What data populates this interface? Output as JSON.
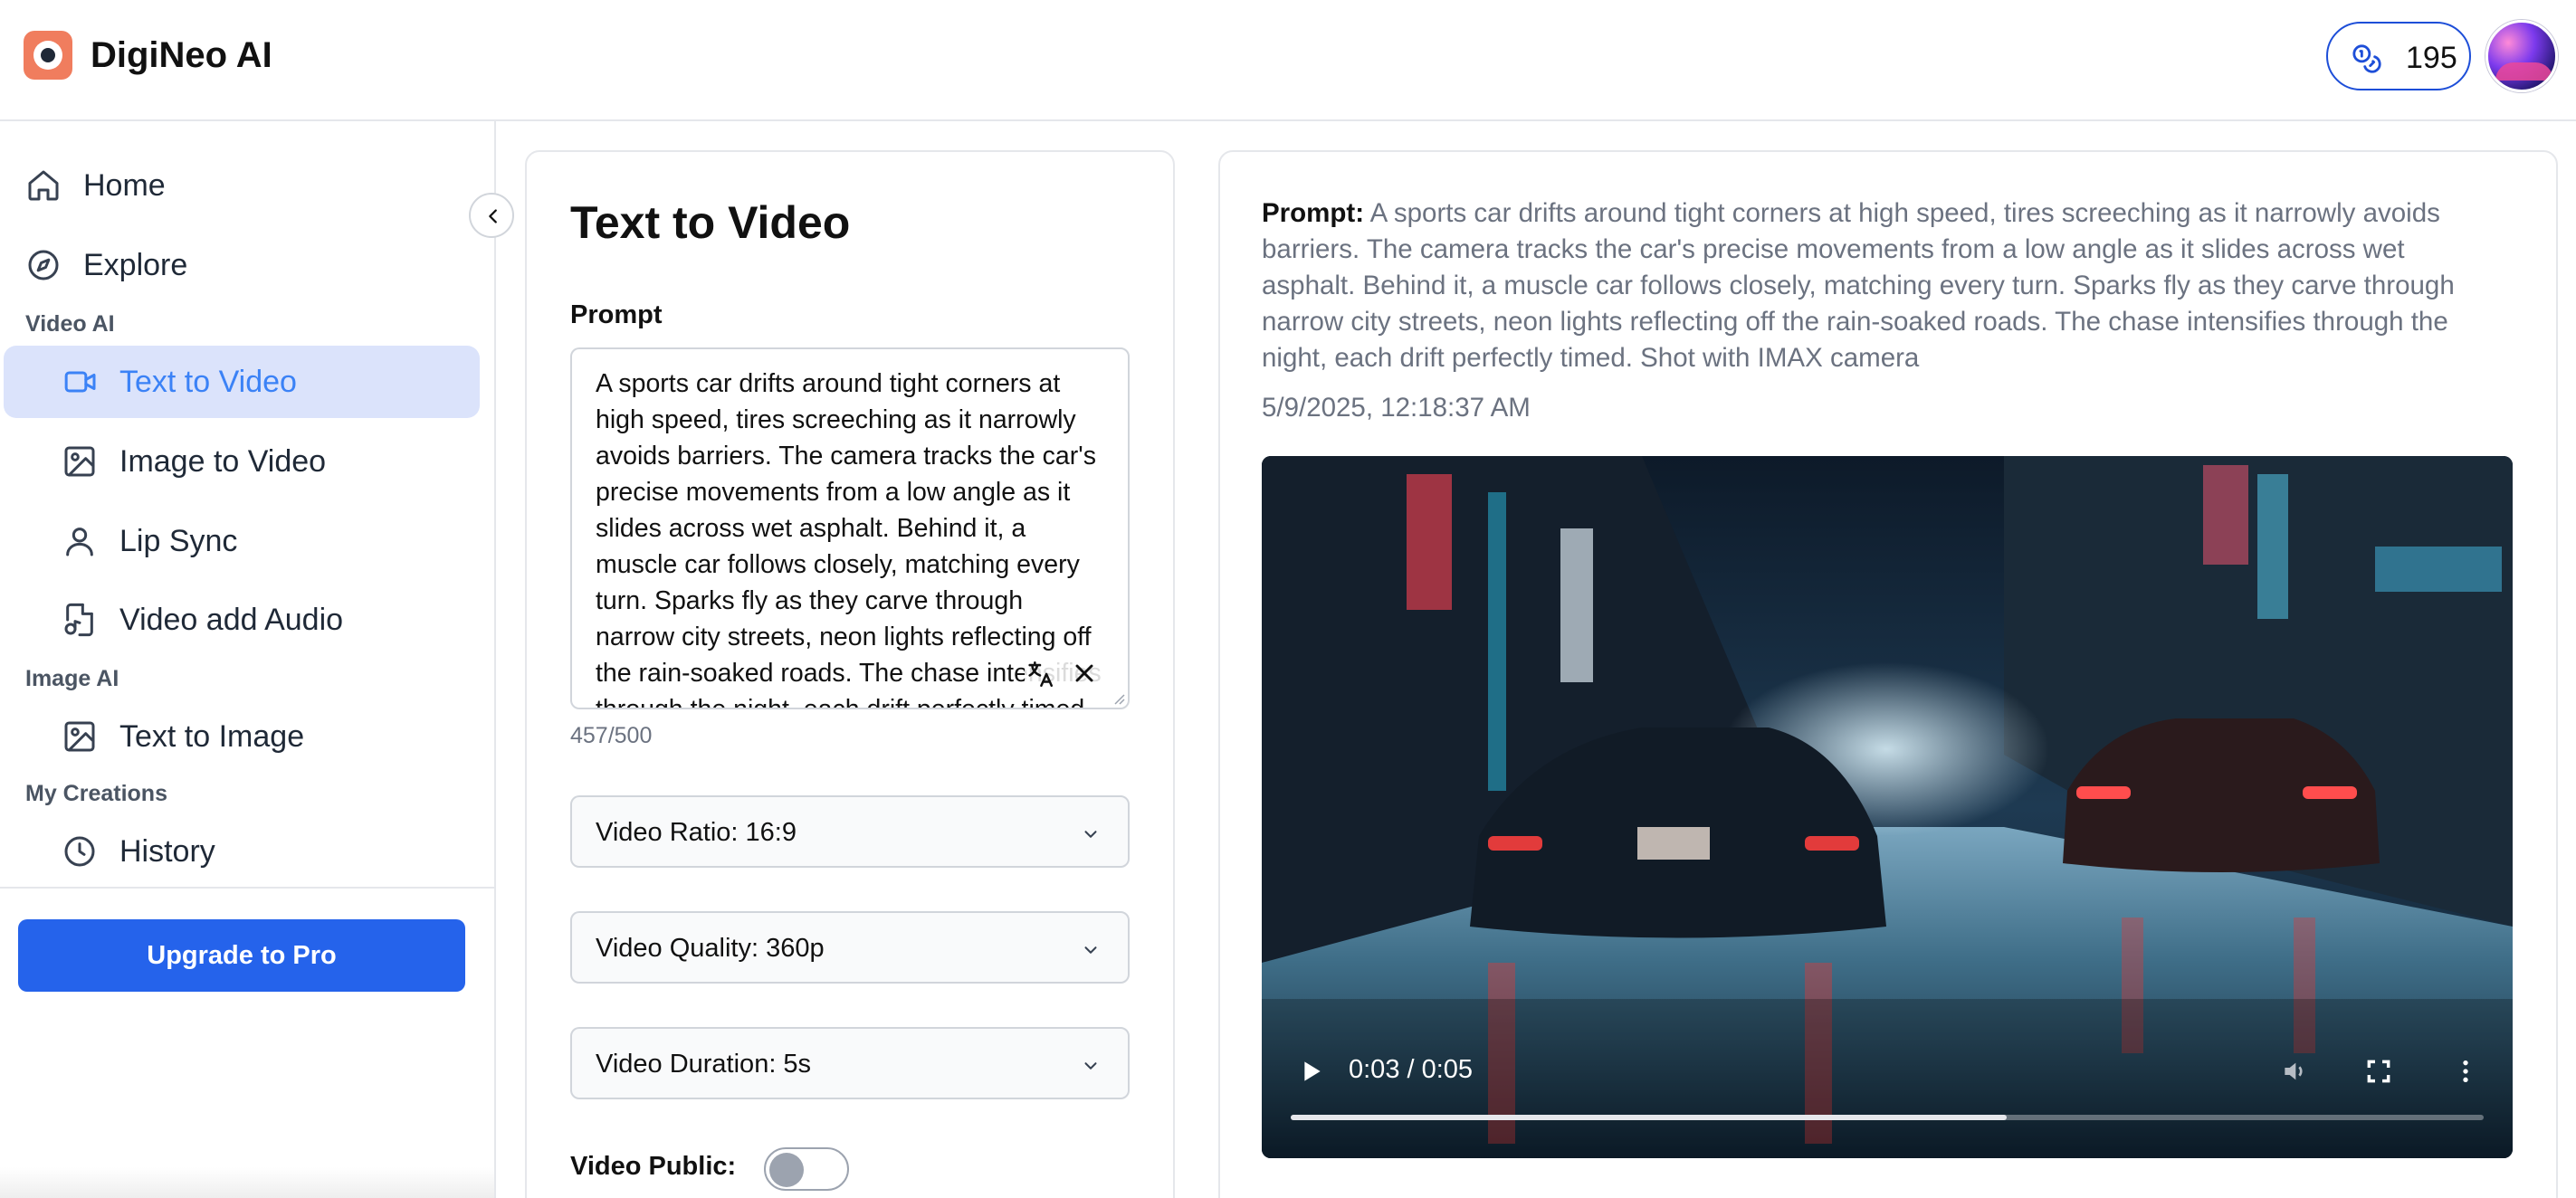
{
  "app": {
    "brand_name": "DigiNeo AI",
    "credits": "195",
    "accent_color": "#2563eb",
    "icons": {
      "logo": "camera-logo-icon",
      "credits": "coins-icon",
      "avatar": "user-avatar"
    }
  },
  "sidebar": {
    "items": [
      {
        "label": "Home",
        "icon": "home-icon"
      },
      {
        "label": "Explore",
        "icon": "compass-icon"
      }
    ],
    "sections": [
      {
        "title": "Video AI",
        "items": [
          {
            "label": "Text to Video",
            "icon": "video-camera-icon",
            "active": true
          },
          {
            "label": "Image to Video",
            "icon": "image-icon"
          },
          {
            "label": "Lip Sync",
            "icon": "user-icon"
          },
          {
            "label": "Video add Audio",
            "icon": "file-audio-icon"
          }
        ]
      },
      {
        "title": "Image AI",
        "items": [
          {
            "label": "Text to Image",
            "icon": "image-icon"
          }
        ]
      },
      {
        "title": "My Creations",
        "items": [
          {
            "label": "History",
            "icon": "clock-icon"
          }
        ]
      }
    ],
    "upgrade_label": "Upgrade to Pro"
  },
  "form": {
    "title": "Text to Video",
    "prompt_label": "Prompt",
    "prompt_value": "A sports car drifts around tight corners at high speed, tires screeching as it narrowly avoids barriers. The camera tracks the car's precise movements from a low angle as it slides across wet asphalt. Behind it, a muscle car follows closely, matching every turn. Sparks fly as they carve through narrow city streets, neon lights reflecting off the rain-soaked roads. The chase intensifies through the night, each drift perfectly timed. Shot with IMAX camera",
    "char_count": "457/500",
    "ratio": "Video Ratio: 16:9",
    "quality": "Video Quality: 360p",
    "duration": "Video Duration: 5s",
    "public_label": "Video Public:",
    "public_enabled": false
  },
  "result": {
    "prompt_label": "Prompt:",
    "prompt_text": "A sports car drifts around tight corners at high speed, tires screeching as it narrowly avoids barriers. The camera tracks the car's precise movements from a low angle as it slides across wet asphalt. Behind it, a muscle car follows closely, matching every turn. Sparks fly as they carve through narrow city streets, neon lights reflecting off the rain-soaked roads. The chase intensifies through the night, each drift perfectly timed. Shot with IMAX camera",
    "timestamp": "5/9/2025, 12:18:37 AM",
    "video": {
      "time_display": "0:03 / 0:05",
      "progress": 0.6
    }
  }
}
